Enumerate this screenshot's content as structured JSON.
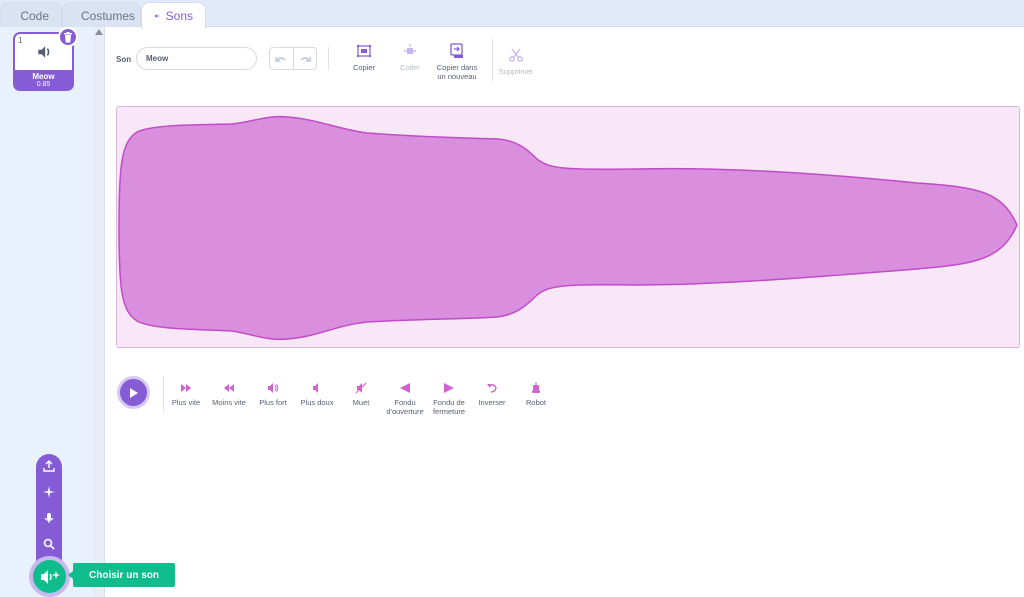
{
  "tabs": [
    {
      "label": "Code"
    },
    {
      "label": "Costumes"
    },
    {
      "label": "Sons"
    }
  ],
  "sound_list": [
    {
      "index": "1",
      "name": "Meow",
      "duration": "0.85"
    }
  ],
  "editor": {
    "sound_label": "Son",
    "sound_name": "Meow"
  },
  "tools": {
    "copy": "Copier",
    "paste": "Coller",
    "copy_new": "Copier dans un nouveau",
    "delete": "Supprimer"
  },
  "effects": [
    {
      "label": "Plus vite"
    },
    {
      "label": "Moins vite"
    },
    {
      "label": "Plus fort"
    },
    {
      "label": "Plus doux"
    },
    {
      "label": "Muet"
    },
    {
      "label": "Fondu d'ouverture"
    },
    {
      "label": "Fondu de fermeture"
    },
    {
      "label": "Inverser"
    },
    {
      "label": "Robot"
    }
  ],
  "add_sound": {
    "tooltip": "Choisir un son"
  },
  "colors": {
    "accent": "#855cd6",
    "wave": "#d98ede",
    "add_button": "#0fbd8c"
  },
  "icons": {
    "add_menu": [
      "upload-icon",
      "surprise-icon",
      "record-icon",
      "search-icon"
    ]
  }
}
